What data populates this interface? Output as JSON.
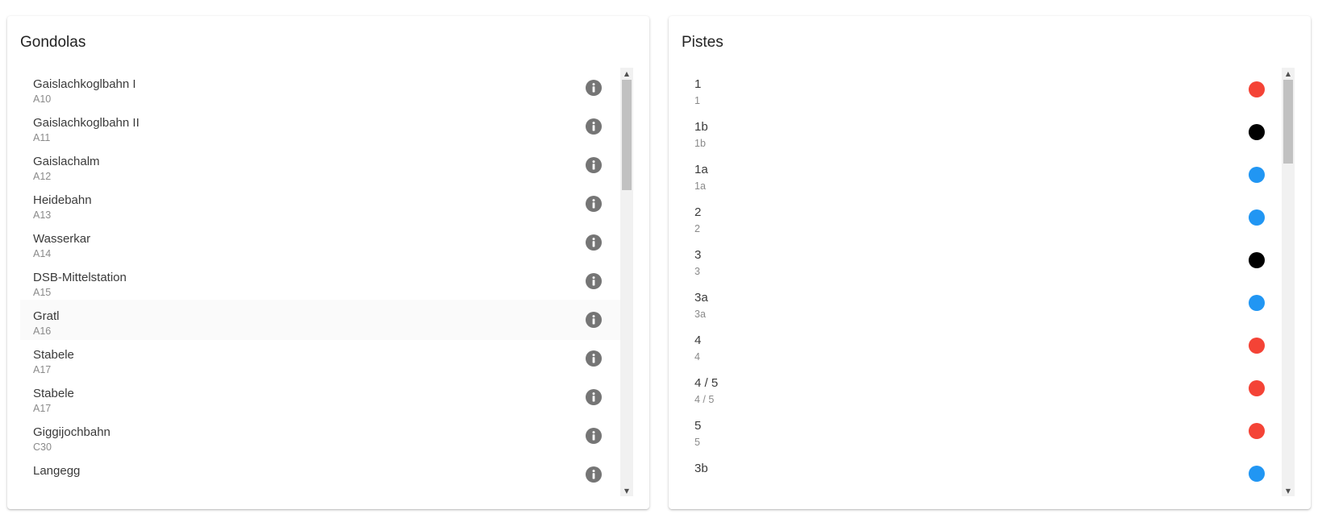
{
  "gondolas": {
    "title": "Gondolas",
    "items": [
      {
        "name": "Gaislachkoglbahn I",
        "code": "A10"
      },
      {
        "name": "Gaislachkoglbahn II",
        "code": "A11"
      },
      {
        "name": "Gaislachalm",
        "code": "A12"
      },
      {
        "name": "Heidebahn",
        "code": "A13"
      },
      {
        "name": "Wasserkar",
        "code": "A14"
      },
      {
        "name": "DSB-Mittelstation",
        "code": "A15"
      },
      {
        "name": "Gratl",
        "code": "A16"
      },
      {
        "name": "Stabele",
        "code": "A17"
      },
      {
        "name": "Stabele",
        "code": "A17"
      },
      {
        "name": "Giggijochbahn",
        "code": "C30"
      },
      {
        "name": "Langegg",
        "code": ""
      }
    ],
    "item_icon": "info-icon",
    "info_icon_color": "#757575",
    "hover_row_index": 6
  },
  "pistes": {
    "title": "Pistes",
    "items": [
      {
        "name": "1",
        "sub": "1",
        "difficulty_color": "#f44336"
      },
      {
        "name": "1b",
        "sub": "1b",
        "difficulty_color": "#000000"
      },
      {
        "name": "1a",
        "sub": "1a",
        "difficulty_color": "#2196f3"
      },
      {
        "name": "2",
        "sub": "2",
        "difficulty_color": "#2196f3"
      },
      {
        "name": "3",
        "sub": "3",
        "difficulty_color": "#000000"
      },
      {
        "name": "3a",
        "sub": "3a",
        "difficulty_color": "#2196f3"
      },
      {
        "name": "4",
        "sub": "4",
        "difficulty_color": "#f44336"
      },
      {
        "name": "4 / 5",
        "sub": "4 / 5",
        "difficulty_color": "#f44336"
      },
      {
        "name": "5",
        "sub": "5",
        "difficulty_color": "#f44336"
      },
      {
        "name": "3b",
        "sub": "",
        "difficulty_color": "#2196f3"
      }
    ]
  },
  "scrollbar": {
    "up_arrow_icon": "triangle-up-icon",
    "down_arrow_icon": "triangle-down-icon"
  }
}
